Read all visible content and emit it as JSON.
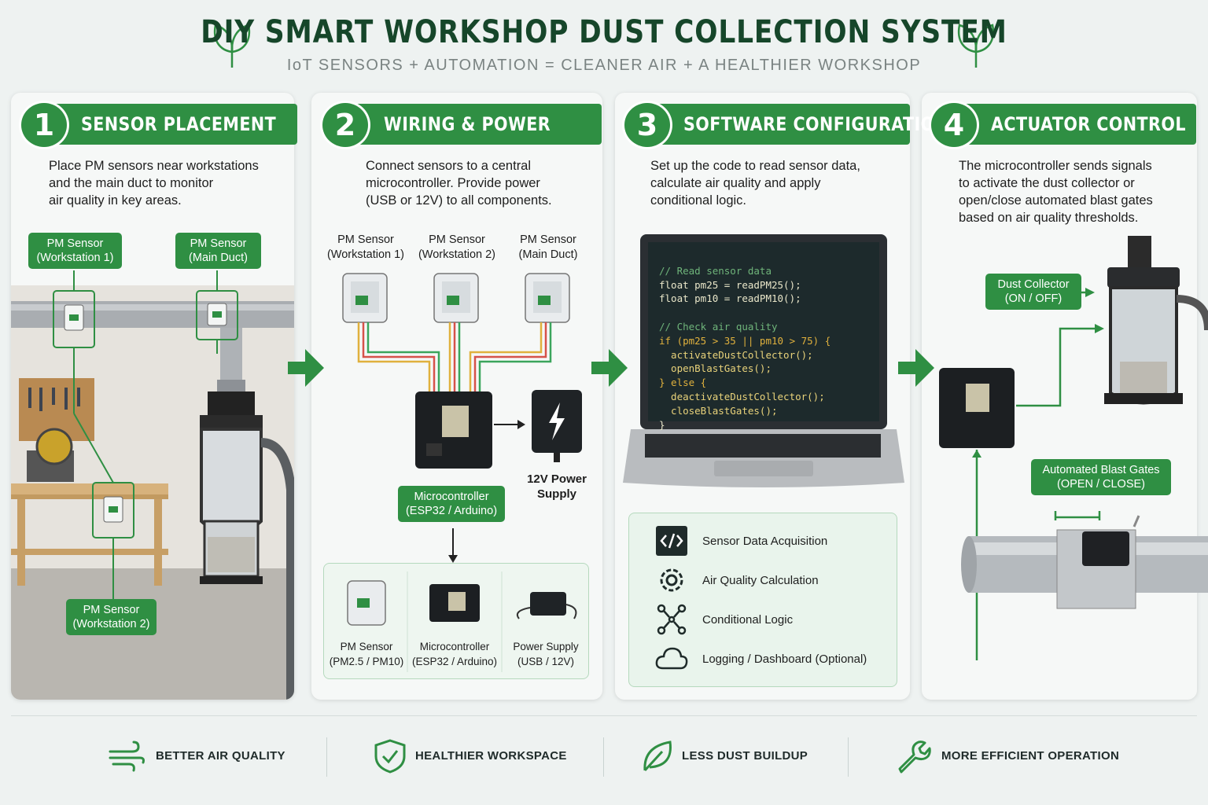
{
  "header": {
    "title": "DIY SMART WORKSHOP DUST COLLECTION SYSTEM",
    "subtitle": "IoT SENSORS  +  AUTOMATION  =  CLEANER AIR  +  A HEALTHIER WORKSHOP"
  },
  "steps": [
    {
      "number": "1",
      "title": "SENSOR PLACEMENT",
      "description": "Place PM sensors near workstations\nand the main duct to monitor\nair quality in key areas.",
      "tags": [
        "PM Sensor\n(Workstation 1)",
        "PM Sensor\n(Main Duct)",
        "PM Sensor\n(Workstation 2)"
      ]
    },
    {
      "number": "2",
      "title": "WIRING & POWER",
      "description": "Connect sensors to a central\nmicrocontroller. Provide power\n(USB or 12V) to all components.",
      "sensor_labels": [
        "PM Sensor\n(Workstation 1)",
        "PM Sensor\n(Workstation 2)",
        "PM Sensor\n(Main Duct)"
      ],
      "microcontroller_tag": "Microcontroller\n(ESP32 / Arduino)",
      "power_label": "12V Power\nSupply",
      "components": [
        "PM Sensor\n(PM2.5 / PM10)",
        "Microcontroller\n(ESP32 / Arduino)",
        "Power Supply\n(USB / 12V)"
      ]
    },
    {
      "number": "3",
      "title": "SOFTWARE CONFIGURATION",
      "description": "Set up the code to read sensor data,\ncalculate air quality and apply\nconditional logic.",
      "code_lines": [
        "// Read sensor data",
        "float pm25 = readPM25();",
        "float pm10 = readPM10();",
        "",
        "// Check air quality",
        "if (pm25 > 35 || pm10 > 75) {",
        "  activateDustCollector();",
        "  openBlastGates();",
        "} else {",
        "  deactivateDustCollector();",
        "  closeBlastGates();",
        "}"
      ],
      "features": [
        "Sensor Data Acquisition",
        "Air Quality Calculation",
        "Conditional Logic",
        "Logging / Dashboard (Optional)"
      ]
    },
    {
      "number": "4",
      "title": "ACTUATOR CONTROL",
      "description": "The microcontroller sends signals\nto activate the dust collector or\nopen/close automated blast gates\nbased on air quality thresholds.",
      "tags": [
        "Dust Collector\n(ON / OFF)",
        "Automated Blast Gates\n(OPEN / CLOSE)"
      ]
    }
  ],
  "benefits": [
    "BETTER AIR QUALITY",
    "HEALTHIER WORKSPACE",
    "LESS DUST BUILDUP",
    "MORE EFFICIENT OPERATION"
  ],
  "colors": {
    "brand_green": "#2f8f43",
    "title_green": "#16462a",
    "background": "#eef2f1",
    "code_bg": "#1d2a2c"
  }
}
